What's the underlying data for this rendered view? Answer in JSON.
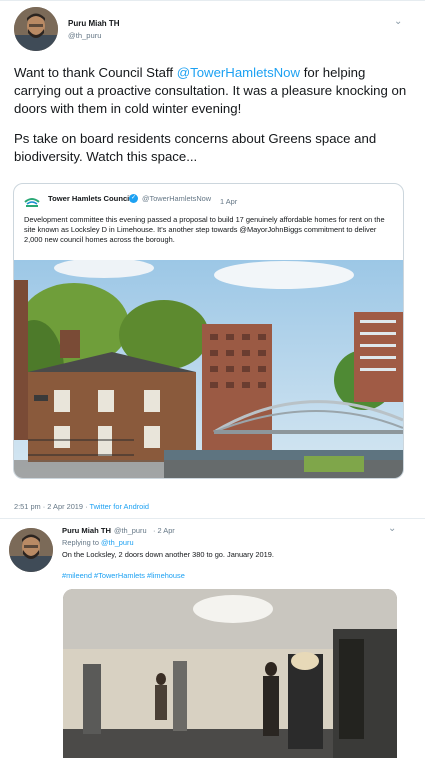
{
  "tweet": {
    "author_name": "Puru Miah TH",
    "author_handle": "@th_puru",
    "text_before_mention": "Want to thank Council Staff ",
    "mention": "@TowerHamletsNow",
    "text_after_mention": " for helping carrying out a proactive consultation. It was a pleasure knocking on doors with them in cold winter evening!",
    "paragraph2": "Ps take on board residents concerns about Greens space and biodiversity. Watch this space...",
    "timestamp": "2:51 pm · 2 Apr 2019 · ",
    "source": "Twitter for Android"
  },
  "quoted": {
    "author_name": "Tower Hamlets Council",
    "author_handle": "@TowerHamletsNow",
    "date": "1 Apr",
    "text": "Development committee this evening passed a proposal to build 17 genuinely affordable homes for rent on the site known as Locksley D  in Limehouse. It's another step towards @MayorJohnBiggs commitment to deliver 2,000 new council homes across the borough."
  },
  "reply": {
    "author_name": "Puru Miah TH",
    "author_handle": "@th_puru",
    "date": "· 2 Apr",
    "replying_prefix": "Replying to ",
    "replying_to": "@th_puru",
    "text": "On the Locksley, 2 doors down another 380 to go. January 2019.",
    "hashtags": "#mileend #TowerHamlets #limehouse"
  },
  "icons": {
    "menu": "chevron-down-icon",
    "verified": "verified-badge-icon"
  },
  "colors": {
    "link": "#1da1f2",
    "secondary": "#657786",
    "border": "#ccd6dd"
  }
}
